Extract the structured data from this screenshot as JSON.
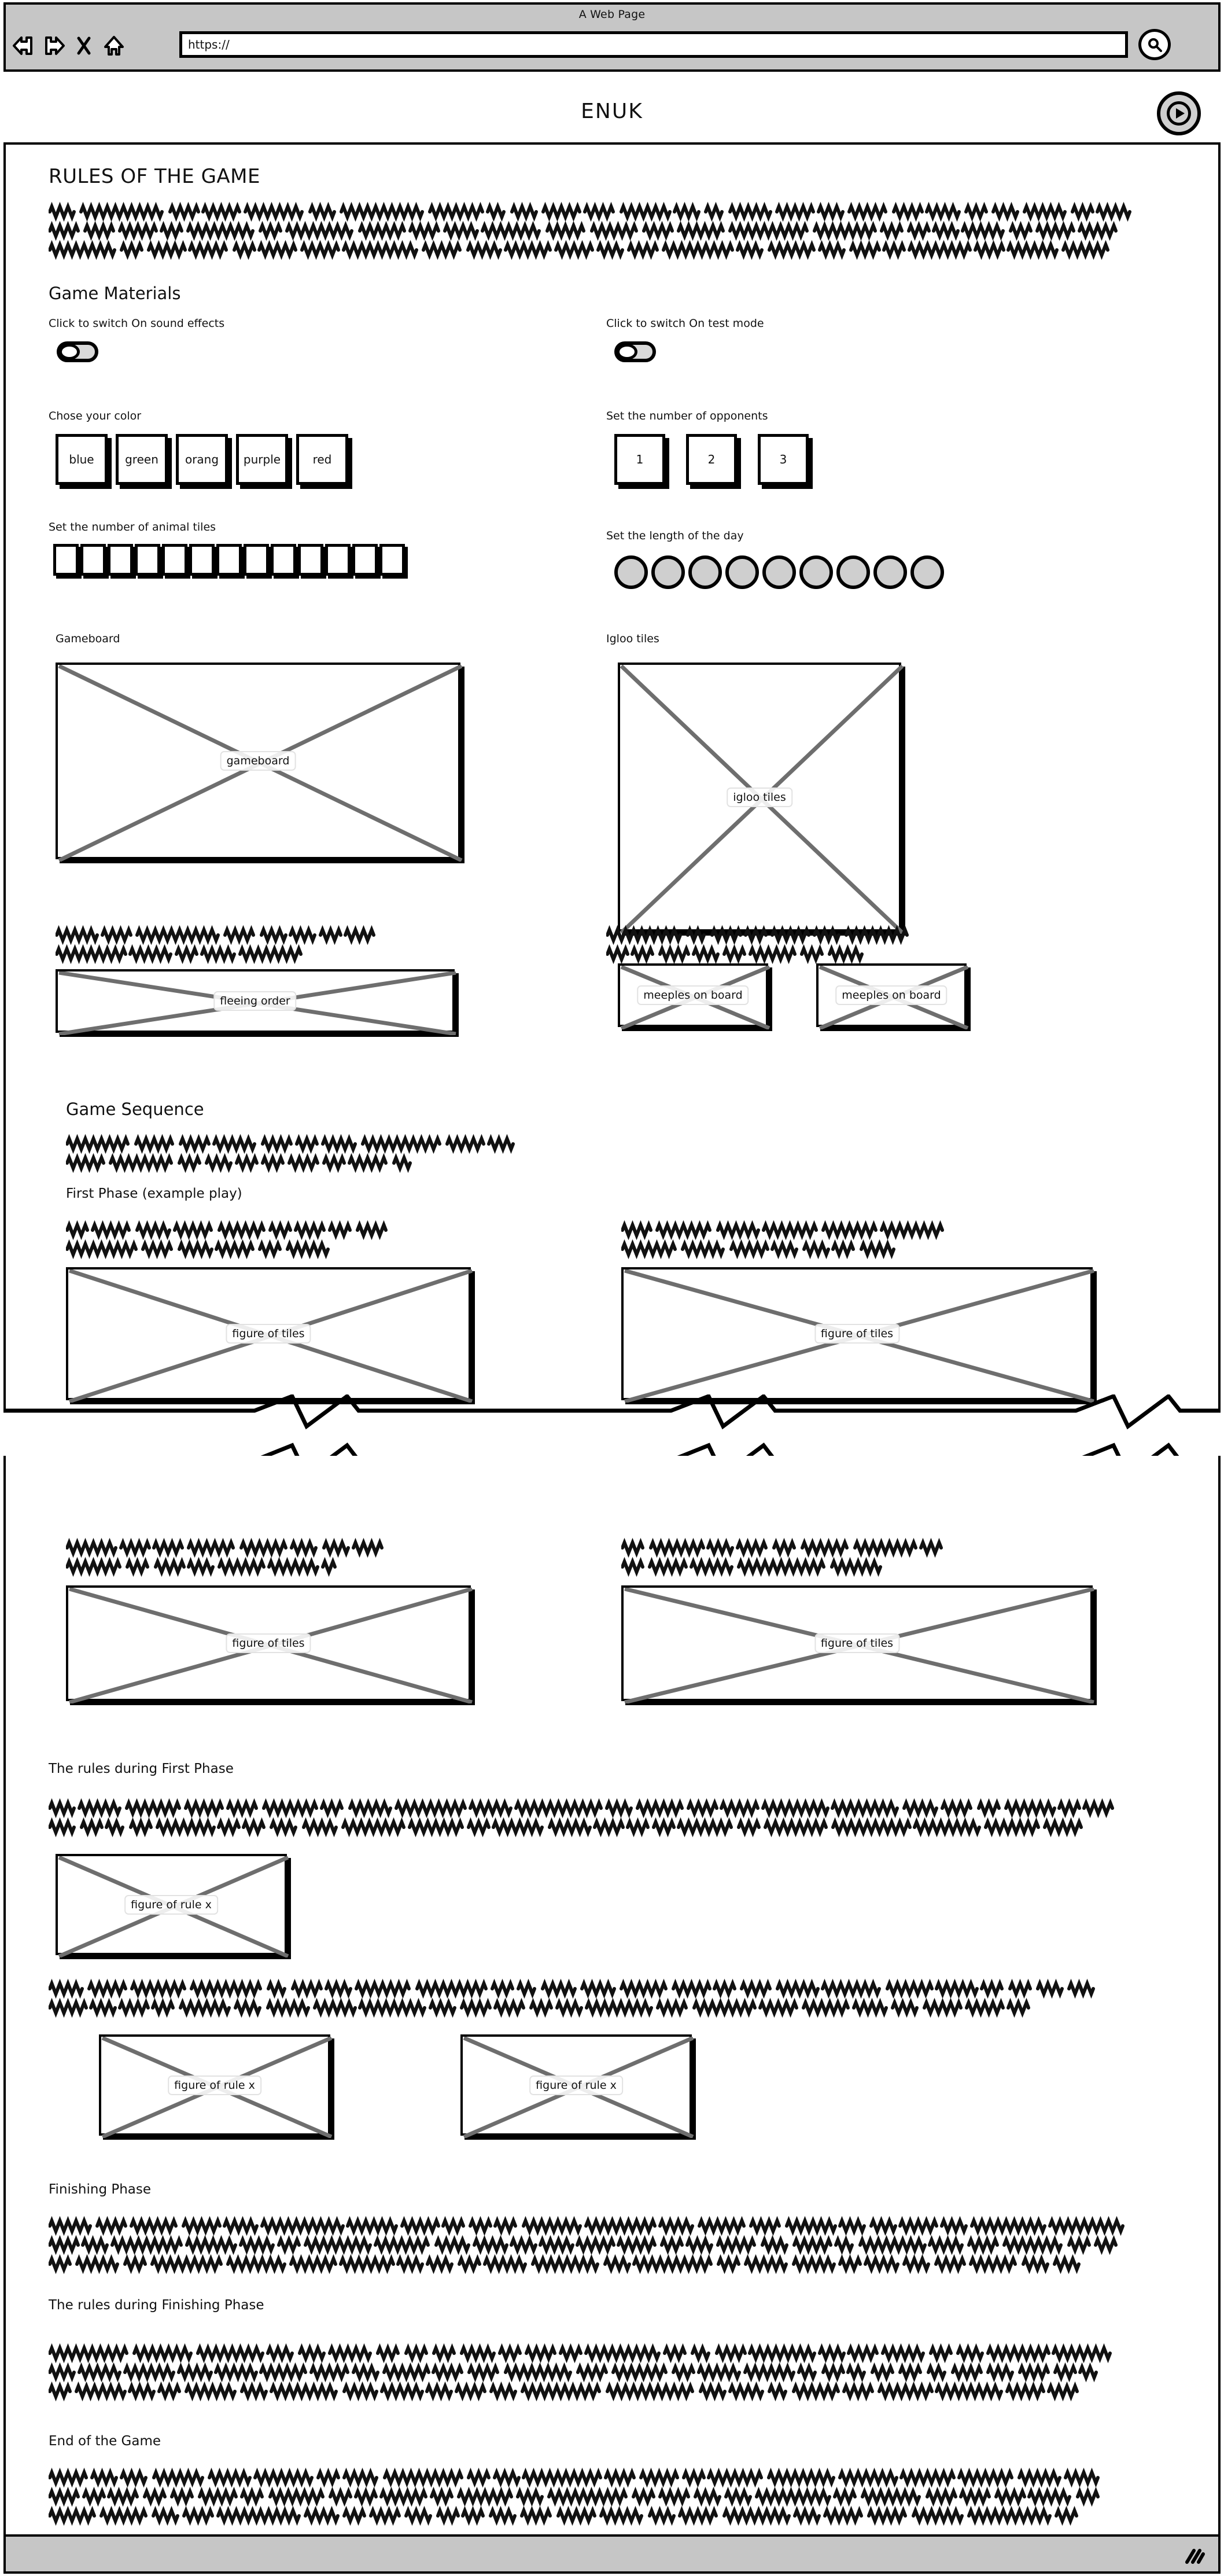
{
  "browser": {
    "window_title": "A Web Page",
    "url_value": "https://",
    "back_icon": "back-arrow-icon",
    "forward_icon": "forward-arrow-icon",
    "stop_icon": "close-x-icon",
    "home_icon": "home-icon",
    "search_icon": "search-icon"
  },
  "site": {
    "title": "ENUK",
    "play_icon": "play-button-icon"
  },
  "page": {
    "title": "RULES OF THE GAME",
    "intro_lines": 3
  },
  "materials": {
    "heading": "Game Materials",
    "sound_toggle_label": "Click to switch On sound effects",
    "test_toggle_label": "Click to switch On test mode",
    "sound_toggle_state": "off",
    "test_toggle_state": "off",
    "color_label": "Chose your color",
    "colors": [
      "blue",
      "green",
      "orang",
      "purple",
      "red"
    ],
    "opponents_label": "Set the number of opponents",
    "opponents": [
      "1",
      "2",
      "3"
    ],
    "animal_tiles_label": "Set the number of animal tiles",
    "animal_tiles_count": 13,
    "day_length_label": "Set the length of the day",
    "day_length_count": 9
  },
  "figures": {
    "gameboard_label": "Gameboard",
    "gameboard_caption": "gameboard",
    "igloo_label": "Igloo tiles",
    "igloo_caption": "igloo tiles",
    "fleeing_caption": "fleeing order",
    "meeples_caption_1": "meeples on board",
    "meeples_caption_2": "meeples on board",
    "tiles_caption": "figure of tiles",
    "rule_caption": "figure of rule x"
  },
  "sequence": {
    "heading": "Game Sequence",
    "first_phase_heading": "First Phase (example play)",
    "first_phase_rules_heading": "The rules during First Phase",
    "finishing_heading": "Finishing Phase",
    "finishing_rules_heading": "The rules during Finishing Phase",
    "end_heading": "End of the Game"
  },
  "status": {
    "resize_grip": "resize-grip-icon"
  },
  "colors": {
    "chrome": "#c6c6c6",
    "ink": "#000000",
    "fill": "#cfcfcf",
    "cross": "#6e6e6e"
  }
}
